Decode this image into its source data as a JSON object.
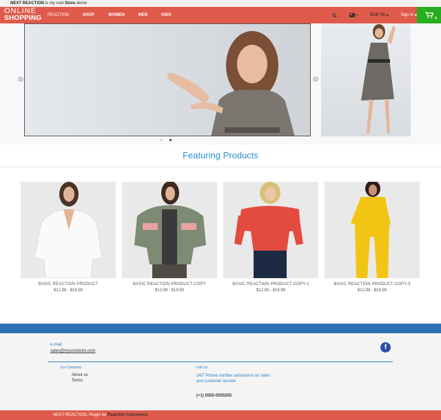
{
  "topbar": {
    "brand": "NEXT REACTION",
    "text_mid": " is my cool ",
    "text_bold": "Store",
    "text_end": " demo"
  },
  "header": {
    "logo_line1": "ONLINE",
    "logo_line2": "SHOPPING",
    "nav": [
      "REACTION",
      "SHOP",
      "WOMEN",
      "MEN",
      "KIDS"
    ],
    "currency": "BOB Sb",
    "signin": "Sign In",
    "cart_count": "0"
  },
  "hero": {
    "active_slide": 2,
    "slides": 2
  },
  "featured": {
    "title": "Featuring Products",
    "products": [
      {
        "name": "BASIC REACTION PRODUCT",
        "price": "$12.99 - $19.99"
      },
      {
        "name": "BASIC REACTION PRODUCT-COPY",
        "price": "$12.99 - $19.99"
      },
      {
        "name": "BASIC REACTION PRODUCT-COPY-2",
        "price": "$12.99 - $19.99"
      },
      {
        "name": "BASIC REACTION PRODUCT-COPY-3",
        "price": "$12.99 - $19.99"
      }
    ]
  },
  "footer": {
    "email_label": "e-mail:",
    "email": "sales@mycoolstore.com",
    "company_heading": "Our Company",
    "about": "About us",
    "terms": "Terms",
    "callus_heading": "Call Us",
    "callus_text": "24/7 Phone number asisntance on sales and customer service",
    "phone": "(+1) 5555-5555555"
  },
  "bottom": {
    "text": "NEXT-REACTION. Plugin for ",
    "link": "Reaction Commerce"
  },
  "colors": {
    "header": "#e05a4b",
    "cart": "#27ae1f",
    "accent": "#2a8fce",
    "band": "#2c70b5"
  }
}
